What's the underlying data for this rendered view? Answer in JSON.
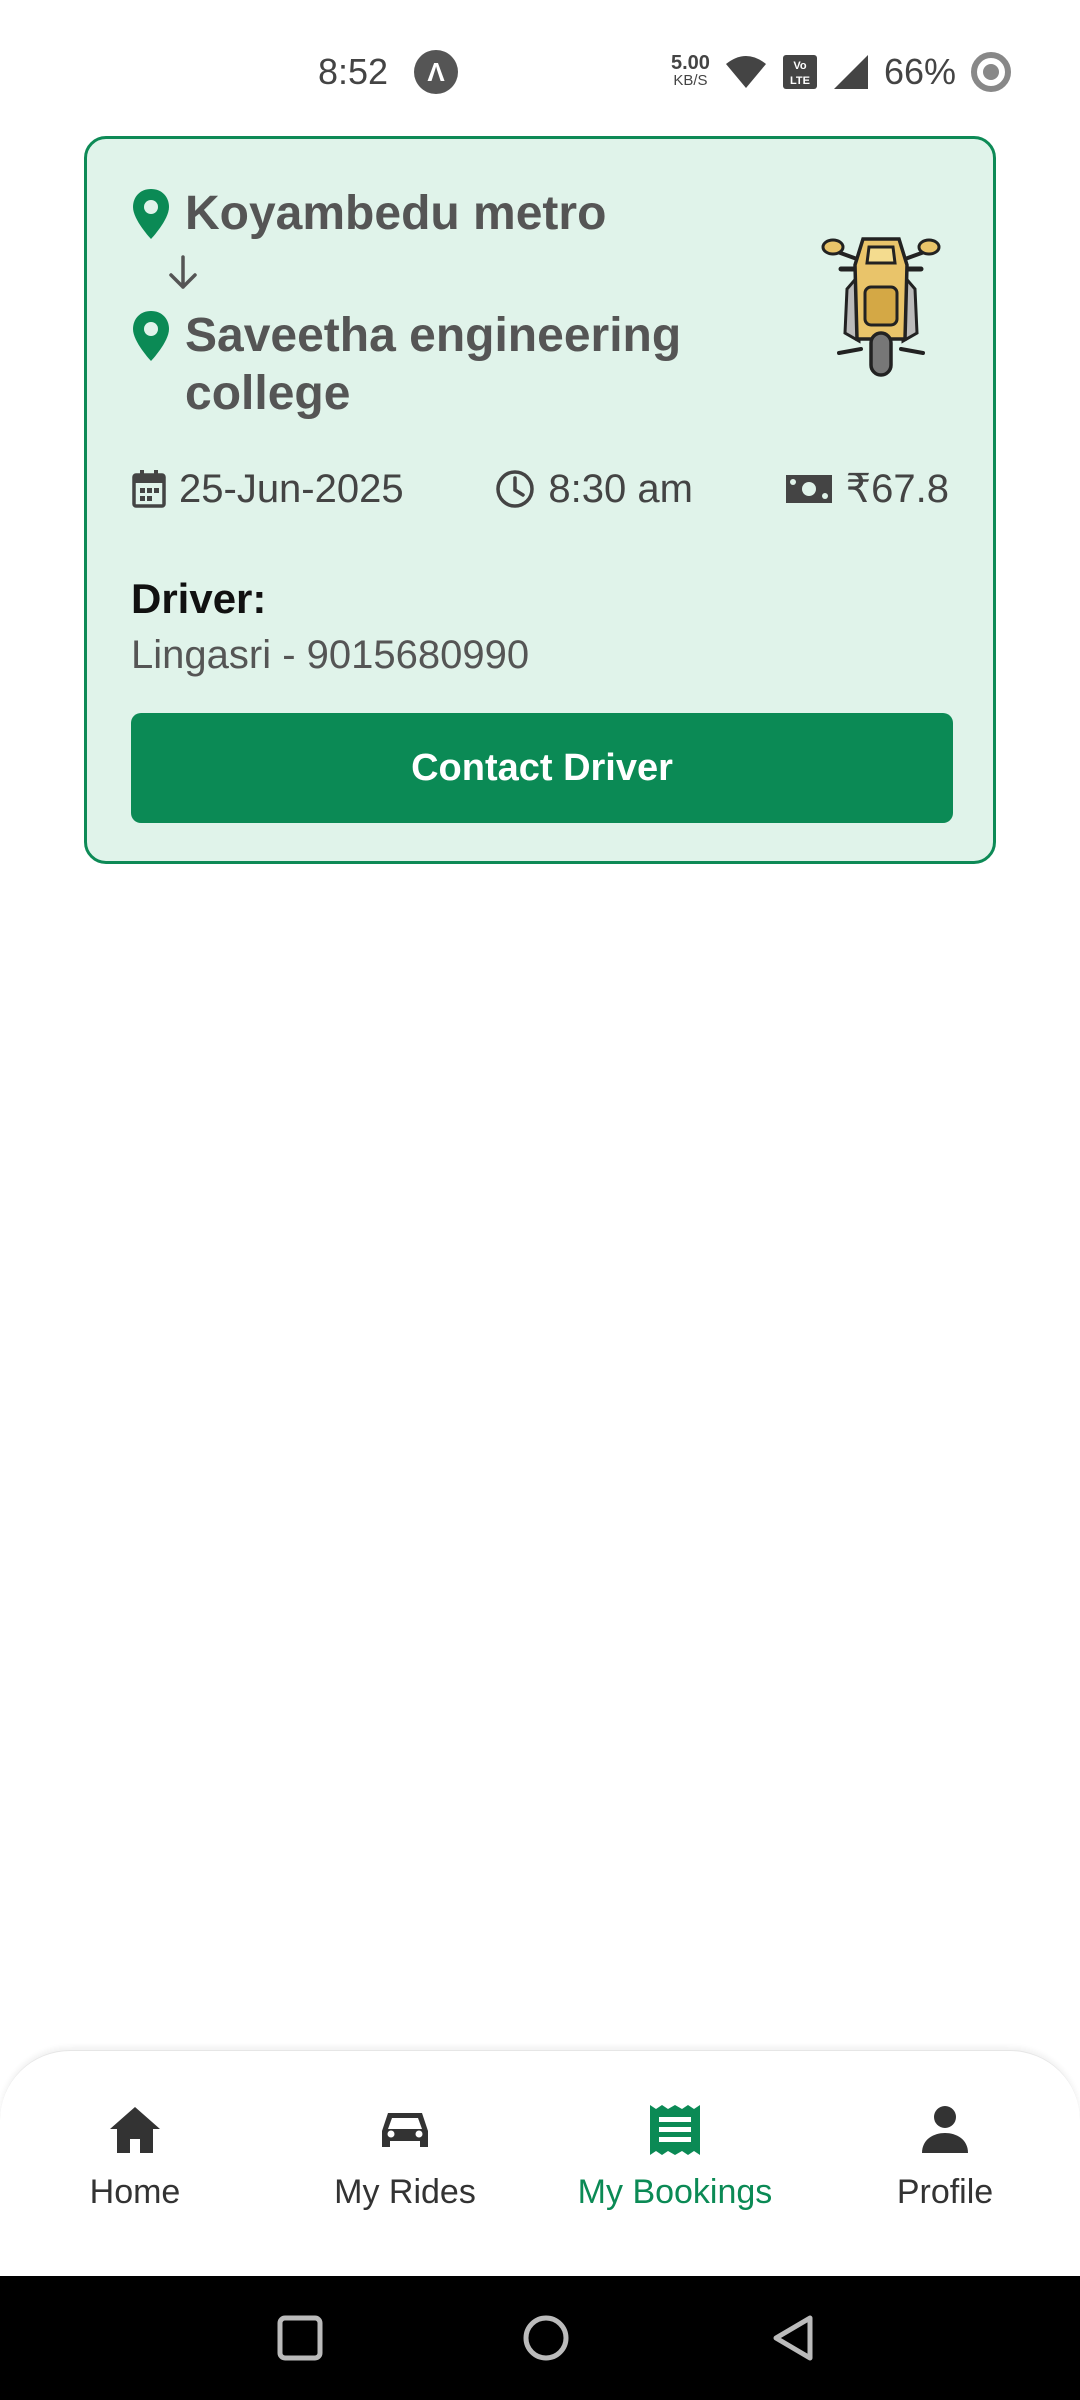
{
  "status_bar": {
    "time": "8:52",
    "net_speed_value": "5.00",
    "net_speed_unit": "KB/S",
    "volte": "Vo LTE",
    "battery": "66%"
  },
  "booking": {
    "from": "Koyambedu metro",
    "to": "Saveetha engineering college",
    "date": "25-Jun-2025",
    "time": "8:30 am",
    "fare": "₹67.8",
    "driver_label": "Driver:",
    "driver_info": "Lingasri - 9015680990",
    "contact_button": "Contact Driver",
    "vehicle_icon": "motorbike-icon"
  },
  "tabs": [
    {
      "label": "Home",
      "icon": "home-icon",
      "active": false
    },
    {
      "label": "My Rides",
      "icon": "car-icon",
      "active": false
    },
    {
      "label": "My Bookings",
      "icon": "receipt-icon",
      "active": true
    },
    {
      "label": "Profile",
      "icon": "person-icon",
      "active": false
    }
  ],
  "colors": {
    "accent": "#0b8a55",
    "card_bg": "#e0f3ea",
    "card_border": "#0d8a56"
  }
}
